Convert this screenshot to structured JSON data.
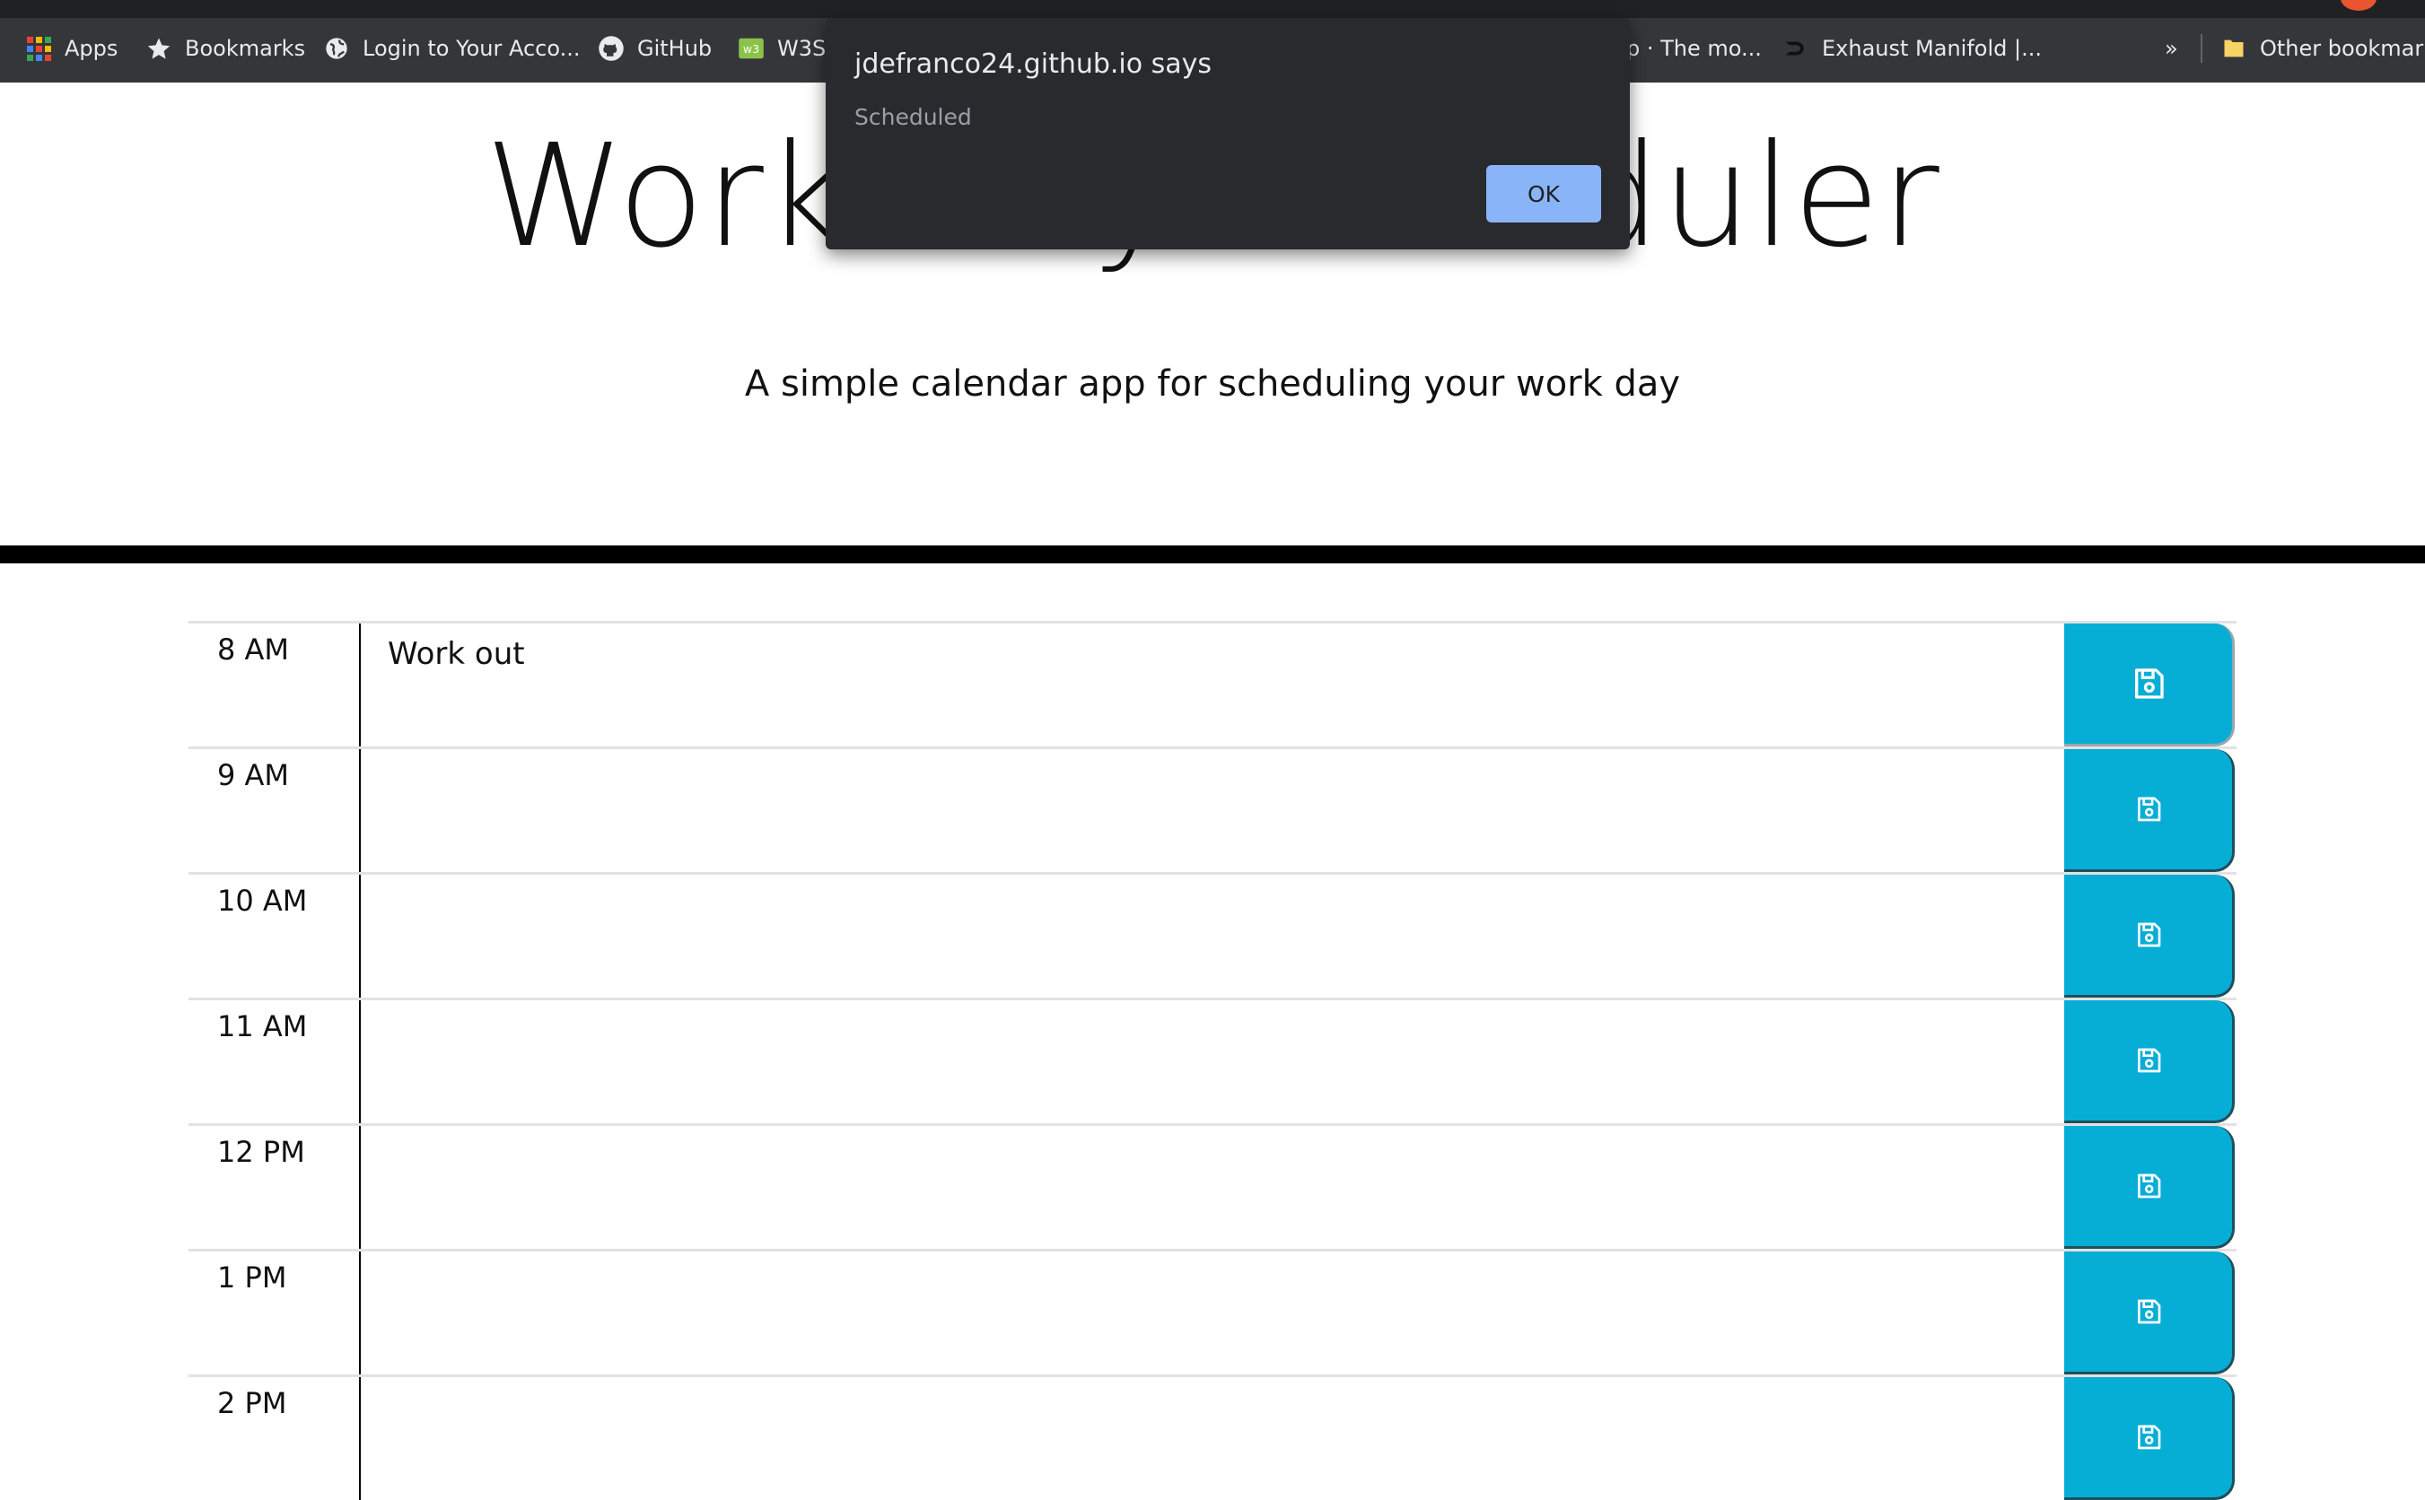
{
  "browser": {
    "bookmarks": [
      {
        "label": "Apps",
        "icon": "apps-grid-icon"
      },
      {
        "label": "Bookmarks",
        "icon": "star-icon"
      },
      {
        "label": "Login to Your Acco...",
        "icon": "globe-icon"
      },
      {
        "label": "GitHub",
        "icon": "github-icon"
      },
      {
        "label": "W3S",
        "icon": "w3schools-icon"
      },
      {
        "label": "p · The mo...",
        "icon": ""
      },
      {
        "label": "Exhaust Manifold |...",
        "icon": "site-favicon-icon"
      }
    ],
    "overflow_label": "»",
    "other_bookmarks_label": "Other bookmarks",
    "colors": {
      "chrome_dark": "#35363a",
      "apps_dots": [
        "#ea4335",
        "#fbbc05",
        "#34a853",
        "#4285f4"
      ]
    }
  },
  "page": {
    "title": "Work Day Scheduler",
    "subtitle": "A simple calendar app for scheduling your work day"
  },
  "time_blocks": [
    {
      "hour": "8 AM",
      "text": "Work out"
    },
    {
      "hour": "9 AM",
      "text": ""
    },
    {
      "hour": "10 AM",
      "text": ""
    },
    {
      "hour": "11 AM",
      "text": ""
    },
    {
      "hour": "12 PM",
      "text": ""
    },
    {
      "hour": "1 PM",
      "text": ""
    },
    {
      "hour": "2 PM",
      "text": ""
    }
  ],
  "save_button": {
    "icon": "save-icon",
    "color": "#06aed5"
  },
  "alert": {
    "title": "jdefranco24.github.io says",
    "message": "Scheduled",
    "ok_label": "OK",
    "ok_color": "#8ab4f8"
  }
}
